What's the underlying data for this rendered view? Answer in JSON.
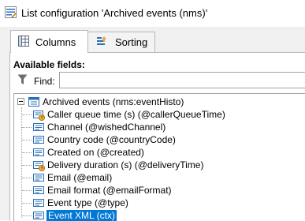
{
  "window": {
    "title": "List configuration 'Archived events (nms)'",
    "icon": "edit-list-icon"
  },
  "tabs": [
    {
      "label": "Columns",
      "icon": "columns-grid-icon",
      "active": true
    },
    {
      "label": "Sorting",
      "icon": "sort-icon",
      "active": false
    }
  ],
  "available_fields": {
    "label": "Available fields:",
    "find_label": "Find:",
    "find_value": ""
  },
  "tree": {
    "root": {
      "label": "Archived events (nms:eventHisto)",
      "icon": "table-icon",
      "expanded": true
    },
    "items": [
      {
        "label": "Caller queue time (s) (@callerQueueTime)",
        "icon": "field-clock-icon",
        "selected": false
      },
      {
        "label": "Channel (@wishedChannel)",
        "icon": "field-icon",
        "selected": false
      },
      {
        "label": "Country code (@countryCode)",
        "icon": "field-icon",
        "selected": false
      },
      {
        "label": "Created on (@created)",
        "icon": "field-icon",
        "selected": false
      },
      {
        "label": "Delivery duration (s) (@deliveryTime)",
        "icon": "field-clock-icon",
        "selected": false
      },
      {
        "label": "Email (@email)",
        "icon": "field-icon",
        "selected": false
      },
      {
        "label": "Email format (@emailFormat)",
        "icon": "field-icon",
        "selected": false
      },
      {
        "label": "Event type (@type)",
        "icon": "field-icon",
        "selected": false
      },
      {
        "label": "Event XML (ctx)",
        "icon": "field-icon",
        "selected": true
      }
    ]
  },
  "colors": {
    "selection": "#0078d7",
    "tab_border": "#b9b9b9",
    "dialog_bg": "#f0f0f0"
  }
}
